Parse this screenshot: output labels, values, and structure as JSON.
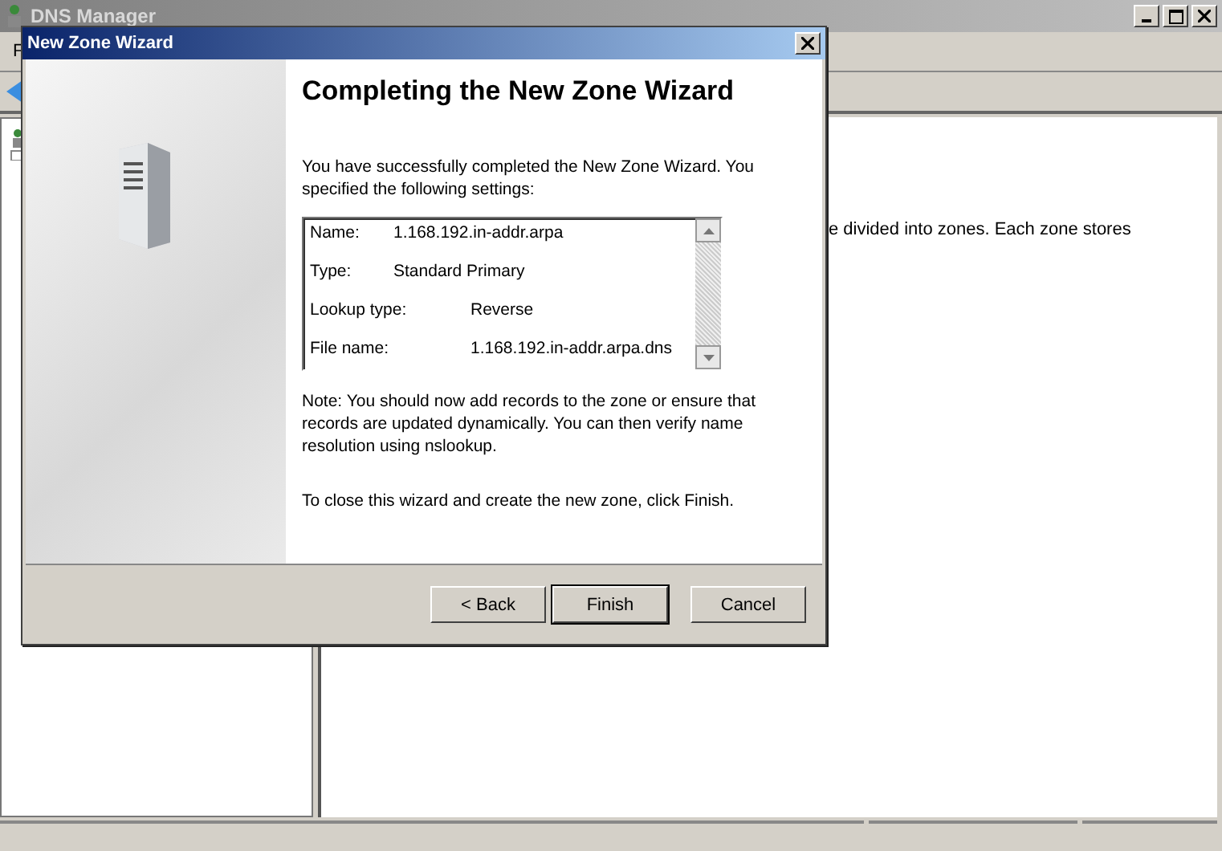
{
  "main_window": {
    "title": "DNS Manager",
    "menu": [
      "F"
    ],
    "right_pane_text": "e divided into zones. Each zone stores"
  },
  "dialog": {
    "title": "New Zone Wizard",
    "heading": "Completing the New Zone Wizard",
    "intro": "You have successfully completed the New Zone Wizard. You specified the following settings:",
    "settings": [
      {
        "label": "Name:",
        "value": "1.168.192.in-addr.arpa"
      },
      {
        "label": "Type:",
        "value": "Standard Primary"
      },
      {
        "label": "Lookup type:",
        "value": "Reverse"
      },
      {
        "label": "File name:",
        "value": "1.168.192.in-addr.arpa.dns"
      }
    ],
    "note": "Note: You should now add records to the zone or ensure that records are updated dynamically. You can then verify name resolution using nslookup.",
    "finish_hint": "To close this wizard and create the new zone, click Finish.",
    "buttons": [
      {
        "label": "< Back",
        "default": false
      },
      {
        "label": "Finish",
        "default": true
      },
      {
        "label": "Cancel",
        "default": false
      }
    ]
  }
}
